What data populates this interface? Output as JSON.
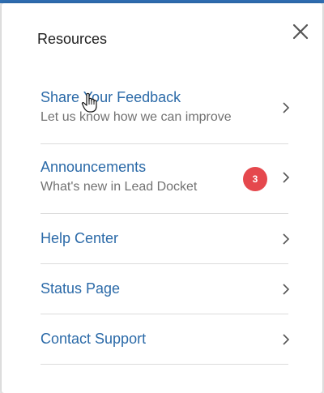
{
  "panel": {
    "title": "Resources",
    "close_icon": "close-icon"
  },
  "colors": {
    "accent_bar": "#2f6fb3",
    "link": "#2b6aa8",
    "badge": "#e5484d"
  },
  "items": [
    {
      "label": "Share Your Feedback",
      "sub": "Let us know how we can improve",
      "icon": "chevron-right-icon"
    },
    {
      "label": "Announcements",
      "sub": "What's new in Lead Docket",
      "badge": "3",
      "icon": "chevron-right-icon"
    },
    {
      "label": "Help Center",
      "icon": "chevron-right-icon"
    },
    {
      "label": "Status Page",
      "icon": "chevron-right-icon"
    },
    {
      "label": "Contact Support",
      "icon": "chevron-right-icon"
    }
  ],
  "cursor": "hand-pointer-icon"
}
